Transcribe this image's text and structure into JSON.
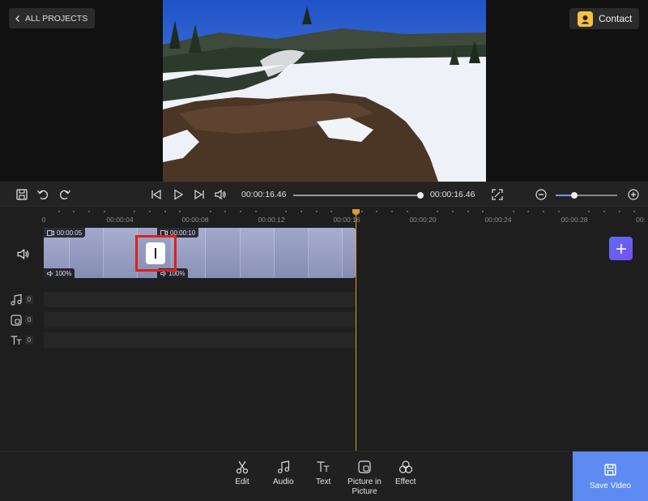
{
  "header": {
    "back_label": "ALL PROJECTS",
    "contact_label": "Contact"
  },
  "player": {
    "current_time": "00:00:16.46",
    "total_time": "00:00:16.46",
    "progress": 1.0,
    "zoom_level": 0.3
  },
  "timeline": {
    "ruler_labels": [
      "0",
      "00:00:04",
      "00:00:08",
      "00:00:12",
      "00:00:16",
      "00:00:20",
      "00:00:24",
      "00:00:28",
      "00:"
    ],
    "clips": [
      {
        "duration": "00:00:05",
        "volume": "100%"
      },
      {
        "duration": "00:00:10",
        "volume": "100%"
      }
    ],
    "track_counts": {
      "audio": "0",
      "pip": "0",
      "text": "0"
    }
  },
  "toolbar": {
    "edit": "Edit",
    "audio": "Audio",
    "text": "Text",
    "pip": "Picture in Picture",
    "effect": "Effect",
    "save": "Save Video"
  },
  "colors": {
    "accent": "#5d8bf2",
    "playhead": "#d89a2b",
    "highlight": "#e0201a"
  }
}
